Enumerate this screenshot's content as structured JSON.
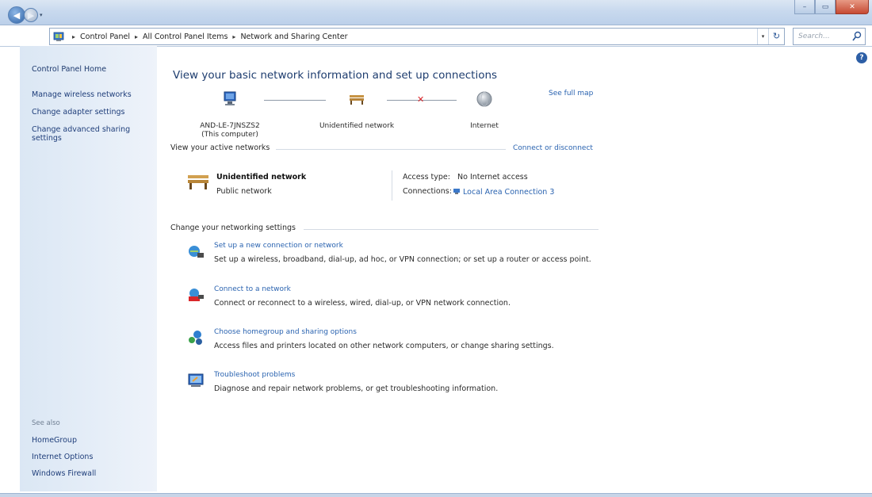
{
  "window": {
    "buttons": {
      "minimize": "–",
      "maximize": "▭",
      "close": "✕"
    }
  },
  "nav": {
    "back_glyph": "◀",
    "forward_glyph": "▶",
    "recent_glyph": "▾"
  },
  "address": {
    "crumbs": [
      "Control Panel",
      "All Control Panel Items",
      "Network and Sharing Center"
    ],
    "separator": "▸",
    "refresh_glyph": "↻",
    "dropdown_glyph": "▾"
  },
  "search": {
    "placeholder": "Search..."
  },
  "help": {
    "glyph": "?"
  },
  "sidebar": {
    "home_label": "Control Panel Home",
    "items": [
      "Manage wireless networks",
      "Change adapter settings",
      "Change advanced sharing settings"
    ],
    "see_also_label": "See also",
    "see_also_items": [
      "HomeGroup",
      "Internet Options",
      "Windows Firewall"
    ]
  },
  "main": {
    "title": "View your basic network information and set up connections",
    "see_full_map": "See full map",
    "map_nodes": [
      {
        "name": "AND-LE-7JNSZS2",
        "sub": "(This computer)",
        "icon": "computer-icon"
      },
      {
        "name": "Unidentified network",
        "sub": "",
        "icon": "bench-network-icon"
      },
      {
        "name": "Internet",
        "sub": "",
        "icon": "globe-icon"
      }
    ],
    "broken_link_glyph": "✕",
    "active_networks_label": "View your active networks",
    "connect_disconnect": "Connect or disconnect",
    "active_network": {
      "name": "Unidentified network",
      "category": "Public network",
      "access_type_label": "Access type:",
      "access_type_value": "No Internet access",
      "connections_label": "Connections:",
      "connections_value": "Local Area Connection 3"
    },
    "change_settings_label": "Change your networking settings",
    "tasks": [
      {
        "link": "Set up a new connection or network",
        "desc": "Set up a wireless, broadband, dial-up, ad hoc, or VPN connection; or set up a router or access point.",
        "icon": "new-connection-icon"
      },
      {
        "link": "Connect to a network",
        "desc": "Connect or reconnect to a wireless, wired, dial-up, or VPN network connection.",
        "icon": "connect-network-icon"
      },
      {
        "link": "Choose homegroup and sharing options",
        "desc": "Access files and printers located on other network computers, or change sharing settings.",
        "icon": "homegroup-icon"
      },
      {
        "link": "Troubleshoot problems",
        "desc": "Diagnose and repair network problems, or get troubleshooting information.",
        "icon": "troubleshoot-icon"
      }
    ]
  },
  "colors": {
    "link": "#2a63b0",
    "title": "#1e3d6f",
    "sidebar_bg": "#dbe7f4",
    "error_x": "#d9262a"
  }
}
